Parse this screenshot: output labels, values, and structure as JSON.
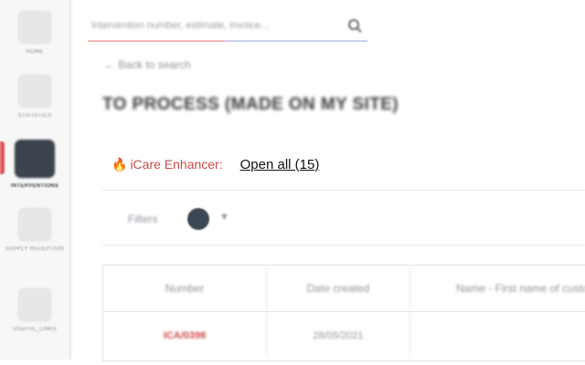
{
  "sidebar": {
    "items": [
      {
        "label": "HOME",
        "active": false,
        "icon": "home-icon"
      },
      {
        "label": "STATISTICS",
        "active": false,
        "icon": "chart-icon"
      },
      {
        "label": "INTERVENTIONS",
        "active": true,
        "icon": "wrench-icon"
      },
      {
        "label": "SUPPLY RECEPTION",
        "active": false,
        "icon": "package-icon"
      },
      {
        "label": "USEFUL_LINKS",
        "active": false,
        "icon": "external-link-icon"
      }
    ]
  },
  "search": {
    "placeholder": "Intervention number, estimate, invoice..."
  },
  "back_link": "Back to search",
  "page_title": "TO PROCESS (MADE ON MY SITE)",
  "enhancer": {
    "name": "iCare Enhancer:",
    "open_all": "Open all (15)"
  },
  "filters": {
    "label": "Filters"
  },
  "table": {
    "columns": [
      "Number",
      "Date created",
      "Name - First name of customer"
    ],
    "rows": [
      {
        "number": "ICA/0398",
        "date": "28/05/2021",
        "name": ""
      }
    ]
  },
  "colors": {
    "accent": "#c94b4b",
    "sidebar_active": "#3b434d"
  }
}
